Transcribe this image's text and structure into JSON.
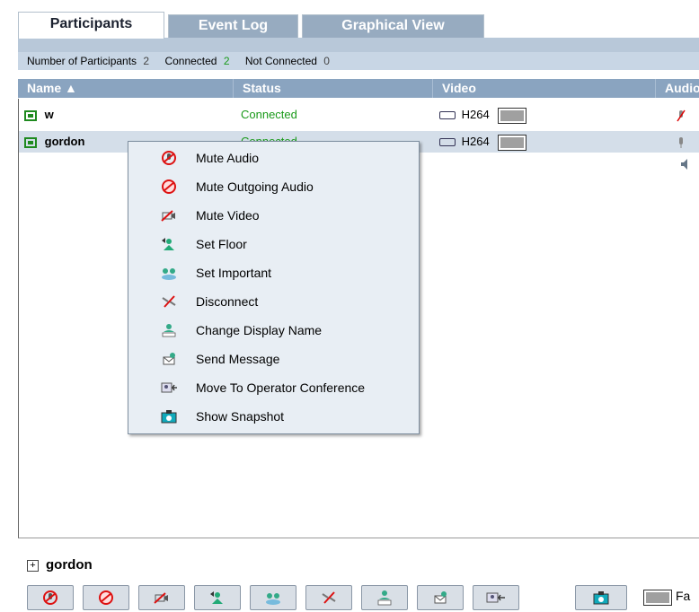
{
  "tabs": [
    {
      "label": "Participants",
      "active": true
    },
    {
      "label": "Event Log",
      "active": false
    },
    {
      "label": "Graphical View",
      "active": false
    }
  ],
  "summary": {
    "participants_label": "Number of Participants",
    "participants_value": "2",
    "connected_label": "Connected",
    "connected_value": "2",
    "not_connected_label": "Not Connected",
    "not_connected_value": "0"
  },
  "columns": [
    "Name ▲",
    "Status",
    "Video",
    "Audio"
  ],
  "rows": [
    {
      "name": "w",
      "status": "Connected",
      "video": "H264"
    },
    {
      "name": "gordon",
      "status": "Connected",
      "video": "H264"
    }
  ],
  "context_menu": [
    {
      "label": "Mute Audio",
      "icon": "mute-audio-icon"
    },
    {
      "label": "Mute Outgoing Audio",
      "icon": "mute-outgoing-audio-icon"
    },
    {
      "label": "Mute Video",
      "icon": "mute-video-icon"
    },
    {
      "label": "Set Floor",
      "icon": "set-floor-icon"
    },
    {
      "label": "Set Important",
      "icon": "set-important-icon"
    },
    {
      "label": "Disconnect",
      "icon": "disconnect-icon"
    },
    {
      "label": "Change Display Name",
      "icon": "change-display-name-icon"
    },
    {
      "label": "Send Message",
      "icon": "send-message-icon"
    },
    {
      "label": "Move To Operator Conference",
      "icon": "move-to-operator-icon"
    },
    {
      "label": "Show Snapshot",
      "icon": "snapshot-icon"
    }
  ],
  "details": {
    "name": "gordon",
    "expand_symbol": "+"
  },
  "toolbar": {
    "layout_label": "Fa"
  },
  "colors": {
    "header_bg": "#8aa4c0",
    "summary_bg": "#c8d6e5",
    "connected_green": "#1a9a1a",
    "menu_bg": "#e8eef4",
    "selected_row": "#d4dee9"
  }
}
